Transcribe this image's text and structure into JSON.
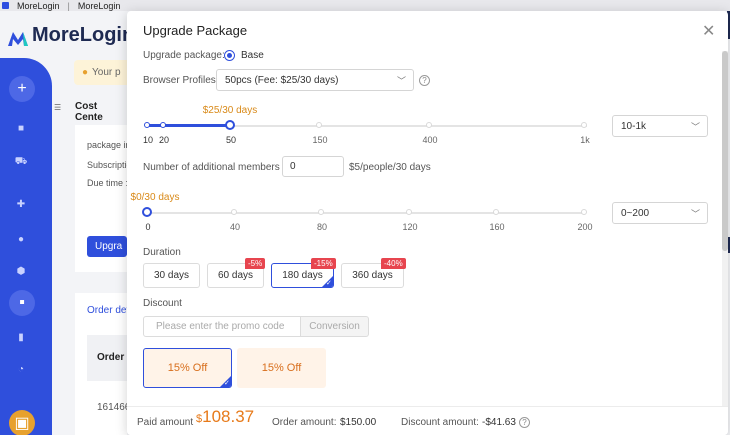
{
  "tabs": [
    "MoreLogin",
    "MoreLogin"
  ],
  "app": {
    "brand": "MoreLogin",
    "notice": "Your p",
    "section_title": "Cost Cente",
    "info_lines": [
      "package in",
      "Subscriptio",
      "Due time :"
    ],
    "upgrade_btn": "Upgra",
    "order_title": "Order det",
    "order_col": "Order",
    "order_id": "161466"
  },
  "modal": {
    "title": "Upgrade Package",
    "package_label": "Upgrade package:",
    "package_value": "Base",
    "profiles_label": "Browser Profiles",
    "profiles_value": "50pcs (Fee: $25/30 days)",
    "profiles_slider": {
      "value_label": "$25/30 days",
      "ticks": [
        "10",
        "20",
        "50",
        "150",
        "400",
        "1k"
      ],
      "selected": "50",
      "range_select": "10-1k"
    },
    "members_label": "Number of additional members",
    "members_value": "0",
    "members_price": "$5/people/30 days",
    "members_slider": {
      "value_label": "$0/30 days",
      "ticks": [
        "0",
        "40",
        "80",
        "120",
        "160",
        "200"
      ],
      "selected": "0",
      "range_select": "0~200"
    },
    "duration_label": "Duration",
    "durations": [
      {
        "label": "30 days",
        "badge": ""
      },
      {
        "label": "60 days",
        "badge": "-5%"
      },
      {
        "label": "180 days",
        "badge": "-15%"
      },
      {
        "label": "360 days",
        "badge": "-40%"
      }
    ],
    "selected_duration": "180 days",
    "discount_label": "Discount",
    "promo_placeholder": "Please enter the promo code",
    "promo_button": "Conversion",
    "coupons": [
      "15% Off",
      "15% Off"
    ],
    "footer": {
      "paid_label": "Paid amount",
      "paid_currency": "$",
      "paid_value": "108.37",
      "order_label": "Order amount:",
      "order_value": "$150.00",
      "discount_label": "Discount amount:",
      "discount_value": "-$41.63"
    }
  },
  "colors": {
    "primary": "#2f4fdc",
    "accent_orange": "#e77a1a",
    "badge_red": "#e7454f"
  }
}
